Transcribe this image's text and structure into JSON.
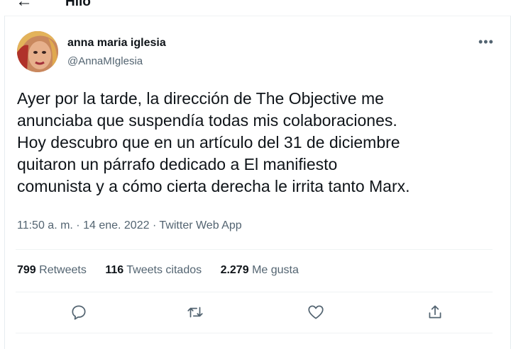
{
  "header": {
    "back_icon": "back-arrow-icon",
    "title": "Hilo"
  },
  "author": {
    "name": "anna maria iglesia",
    "handle": "@AnnaMIglesia"
  },
  "tweet": {
    "text": "Ayer por la tarde, la dirección de The Objective me\nanunciaba que suspendía todas mis colaboraciones.\nHoy descubro que en un artículo del 31 de diciembre\nquitaron un párrafo dedicado a El manifiesto\ncomunista y a cómo cierta derecha le irrita tanto Marx.",
    "meta": "11:50 a. m. · 14 ene. 2022 · Twitter Web App"
  },
  "stats": {
    "retweets_count": "799",
    "retweets_label": "Retweets",
    "quotes_count": "116",
    "quotes_label": "Tweets citados",
    "likes_count": "2.279",
    "likes_label": "Me gusta"
  },
  "actions": [
    "reply-icon",
    "retweet-icon",
    "like-icon",
    "share-icon"
  ],
  "colors": {
    "text": "#0f1419",
    "secondary": "#536471",
    "divider": "#eff3f4"
  }
}
